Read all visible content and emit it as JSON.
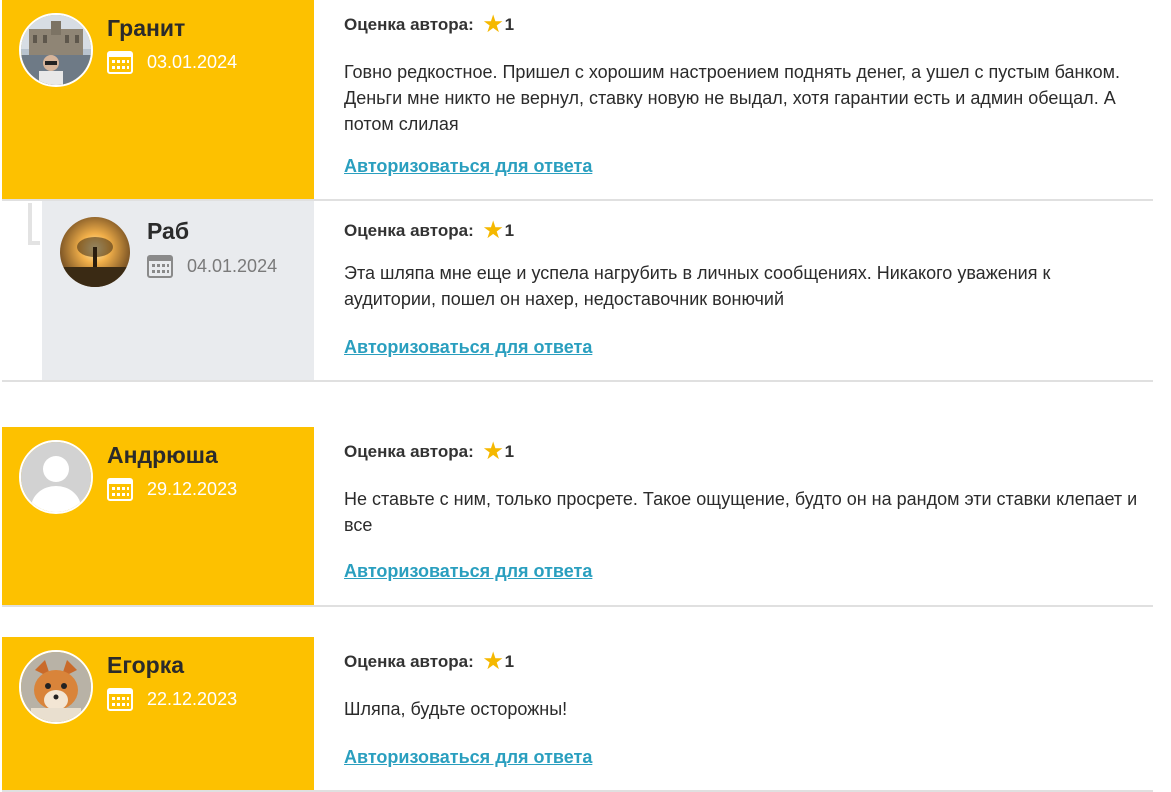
{
  "rating_label": "Оценка автора:",
  "reply_link": "Авторизоваться для ответа",
  "colors": {
    "accent": "#fdc100",
    "reply_bg": "#e9ebee",
    "link": "#2a9fbf",
    "star": "#f5b800"
  },
  "comments": [
    {
      "author": "Гранит",
      "date": "03.01.2024",
      "rating": "1",
      "text": "Говно редкостное. Пришел с хорошим настроением поднять денег, а ушел с пустым банком. Деньги мне никто не вернул, ставку новую не выдал, хотя гарантии есть и админ обещал. А потом слилая"
    },
    {
      "author": "Раб",
      "date": "04.01.2024",
      "rating": "1",
      "text": "Эта шляпа мне еще и успела нагрубить в личных сообщениях. Никакого уважения к аудитории, пошел он нахер, недоставочник вонючий"
    },
    {
      "author": "Андрюша",
      "date": "29.12.2023",
      "rating": "1",
      "text": "Не ставьте с ним, только просрете. Такое ощущение, будто он на рандом эти ставки клепает и все"
    },
    {
      "author": "Егорка",
      "date": "22.12.2023",
      "rating": "1",
      "text": "Шляпа, будьте осторожны!"
    }
  ]
}
